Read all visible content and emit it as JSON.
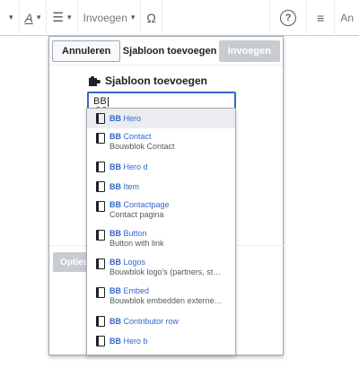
{
  "toolbar": {
    "insert_label": "Invoegen",
    "special_char_glyph": "Ω",
    "help_glyph": "?",
    "menu_glyph": "≡",
    "overflow_text": "An"
  },
  "dialog": {
    "title": "Sjabloon toevoegen",
    "cancel_label": "Annuleren",
    "insert_label": "Invoegen",
    "options_label": "Opties w",
    "section_title": "Sjabloon toevoegen",
    "search_value": "BB",
    "colors": {
      "primary": "#3366cc",
      "disabled": "#c8ccd1"
    }
  },
  "suggestions": [
    {
      "prefix": "BB",
      "rest": " Hero",
      "desc": ""
    },
    {
      "prefix": "BB",
      "rest": " Contact",
      "desc": "Bouwblok Contact"
    },
    {
      "prefix": "BB",
      "rest": " Hero d",
      "desc": ""
    },
    {
      "prefix": "BB",
      "rest": " Item",
      "desc": ""
    },
    {
      "prefix": "BB",
      "rest": " Contactpage",
      "desc": "Contact pagina"
    },
    {
      "prefix": "BB",
      "rest": " Button",
      "desc": "Button with link"
    },
    {
      "prefix": "BB",
      "rest": " Logos",
      "desc": "Bouwblok logo's (partners, stake…"
    },
    {
      "prefix": "BB",
      "rest": " Embed",
      "desc": "Bouwblok embedden externe con…"
    },
    {
      "prefix": "BB",
      "rest": " Contributor row",
      "desc": ""
    },
    {
      "prefix": "BB",
      "rest": " Hero b",
      "desc": ""
    }
  ]
}
